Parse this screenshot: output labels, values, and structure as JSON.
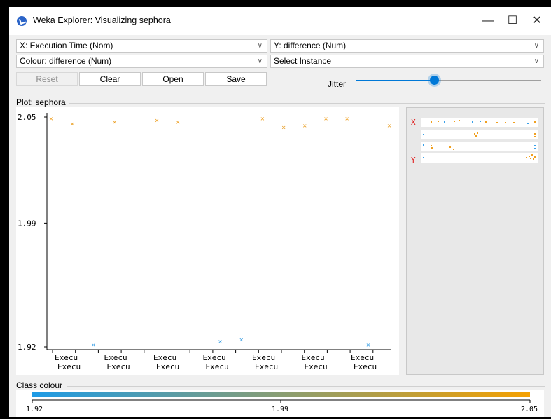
{
  "window": {
    "title": "Weka Explorer: Visualizing sephora",
    "controls": {
      "minimize": "—",
      "maximize": "☐",
      "close": "✕"
    }
  },
  "axes_selectors": {
    "x": "X: Execution Time (Nom)",
    "y": "Y: difference (Num)",
    "colour": "Colour: difference (Num)",
    "instance": "Select Instance"
  },
  "buttons": {
    "reset": "Reset",
    "clear": "Clear",
    "open": "Open",
    "save": "Save"
  },
  "jitter": {
    "label": "Jitter",
    "level": 0.42
  },
  "plot": {
    "legend": "Plot: sephora"
  },
  "class_colour": {
    "legend": "Class colour",
    "min_label": "1.92",
    "mid_label": "1.99",
    "max_label": "2.05",
    "low_color": "#1e9be6",
    "high_color": "#f5a000"
  },
  "side_panel": {
    "x_marker": "X",
    "y_marker": "Y"
  },
  "colors": {
    "low": "#3aa0e8",
    "high": "#f0a020"
  },
  "chart_data": {
    "type": "scatter",
    "title": "",
    "xlabel": "Execution Time (Nom)",
    "ylabel": "difference (Num)",
    "ylim": [
      1.92,
      2.05
    ],
    "y_ticks": [
      "2.05",
      "1.99",
      "1.92"
    ],
    "x_tick_labels_top": [
      "Execu",
      "Execu",
      "Execu",
      "Execu",
      "Execu",
      "Execu",
      "Execu",
      "Execu"
    ],
    "x_tick_labels_bottom": [
      "Execu",
      "Execu",
      "Execu",
      "Execu",
      "Execu",
      "Execu",
      "Execu",
      "Execu"
    ],
    "category_count": 16,
    "points": [
      {
        "x": 0,
        "y": 2.049
      },
      {
        "x": 1,
        "y": 2.046
      },
      {
        "x": 2,
        "y": 1.921
      },
      {
        "x": 3,
        "y": 2.047
      },
      {
        "x": 5,
        "y": 2.048
      },
      {
        "x": 6,
        "y": 2.047
      },
      {
        "x": 8,
        "y": 1.923
      },
      {
        "x": 9,
        "y": 1.924
      },
      {
        "x": 10,
        "y": 2.049
      },
      {
        "x": 11,
        "y": 2.044
      },
      {
        "x": 12,
        "y": 2.045
      },
      {
        "x": 13,
        "y": 2.049
      },
      {
        "x": 14,
        "y": 2.049
      },
      {
        "x": 15,
        "y": 1.921
      },
      {
        "x": 16,
        "y": 2.045
      }
    ]
  }
}
